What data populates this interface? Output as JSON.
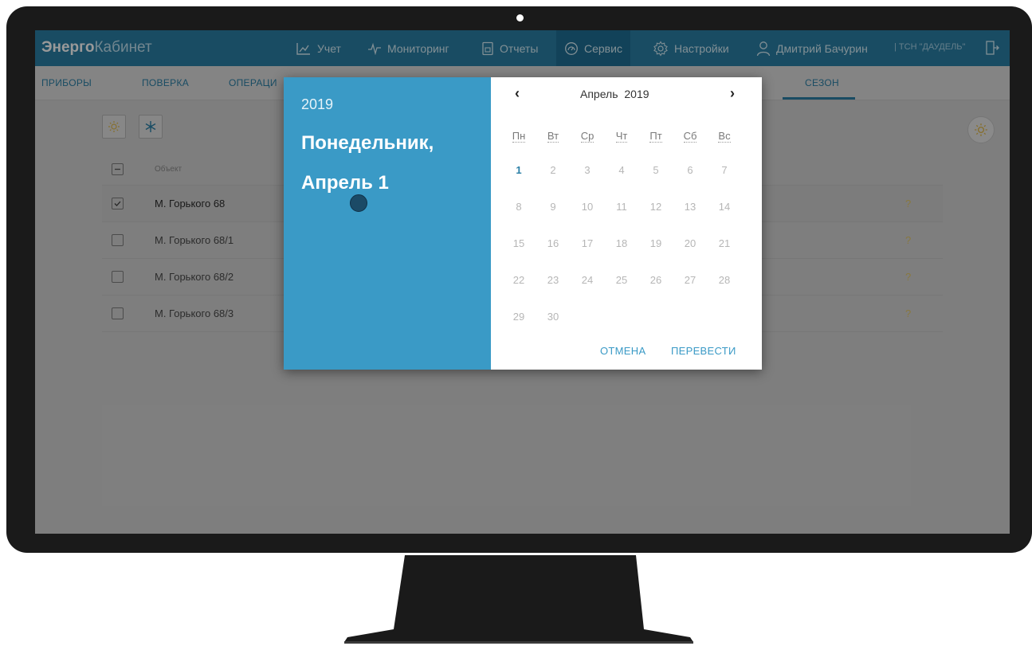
{
  "app": {
    "brand_bold": "Энерго",
    "brand_light": "Кабинет",
    "nav": [
      {
        "label": "Учет",
        "icon": "chart-icon"
      },
      {
        "label": "Мониторинг",
        "icon": "pulse-icon"
      },
      {
        "label": "Отчеты",
        "icon": "report-icon"
      },
      {
        "label": "Сервис",
        "icon": "gauge-icon"
      },
      {
        "label": "Настройки",
        "icon": "gear-icon"
      }
    ],
    "user": "Дмитрий Бачурин",
    "org": "| ТСН \"ДАУДЕЛЬ\""
  },
  "tabs": [
    "ПРИБОРЫ",
    "ПОВЕРКА",
    "ОПЕРАЦИ",
    "СЕЗОН"
  ],
  "table": {
    "header": "Объект",
    "rows": [
      {
        "name": "М. Горького 68",
        "checked": true,
        "mark": "?"
      },
      {
        "name": "М. Горького 68/1",
        "checked": false,
        "mark": "?"
      },
      {
        "name": "М. Горького 68/2",
        "checked": false,
        "mark": "?"
      },
      {
        "name": "М. Горького 68/3",
        "checked": false,
        "mark": "?"
      }
    ]
  },
  "datepicker": {
    "year": "2019",
    "weekday": "Понедельник,",
    "date": "Апрель 1",
    "prev": "‹",
    "next": "›",
    "month": "Апрель",
    "month_year": "2019",
    "weekdays": [
      "Пн",
      "Вт",
      "Ср",
      "Чт",
      "Пт",
      "Сб",
      "Вс"
    ],
    "days": [
      "1",
      "2",
      "3",
      "4",
      "5",
      "6",
      "7",
      "8",
      "9",
      "10",
      "11",
      "12",
      "13",
      "14",
      "15",
      "16",
      "17",
      "18",
      "19",
      "20",
      "21",
      "22",
      "23",
      "24",
      "25",
      "26",
      "27",
      "28",
      "29",
      "30"
    ],
    "selected_day": "1",
    "cancel": "ОТМЕНА",
    "ok": "ПЕРЕВЕСТИ"
  },
  "colors": {
    "accent": "#2a7fa6",
    "picker_header": "#3a9ac6"
  }
}
